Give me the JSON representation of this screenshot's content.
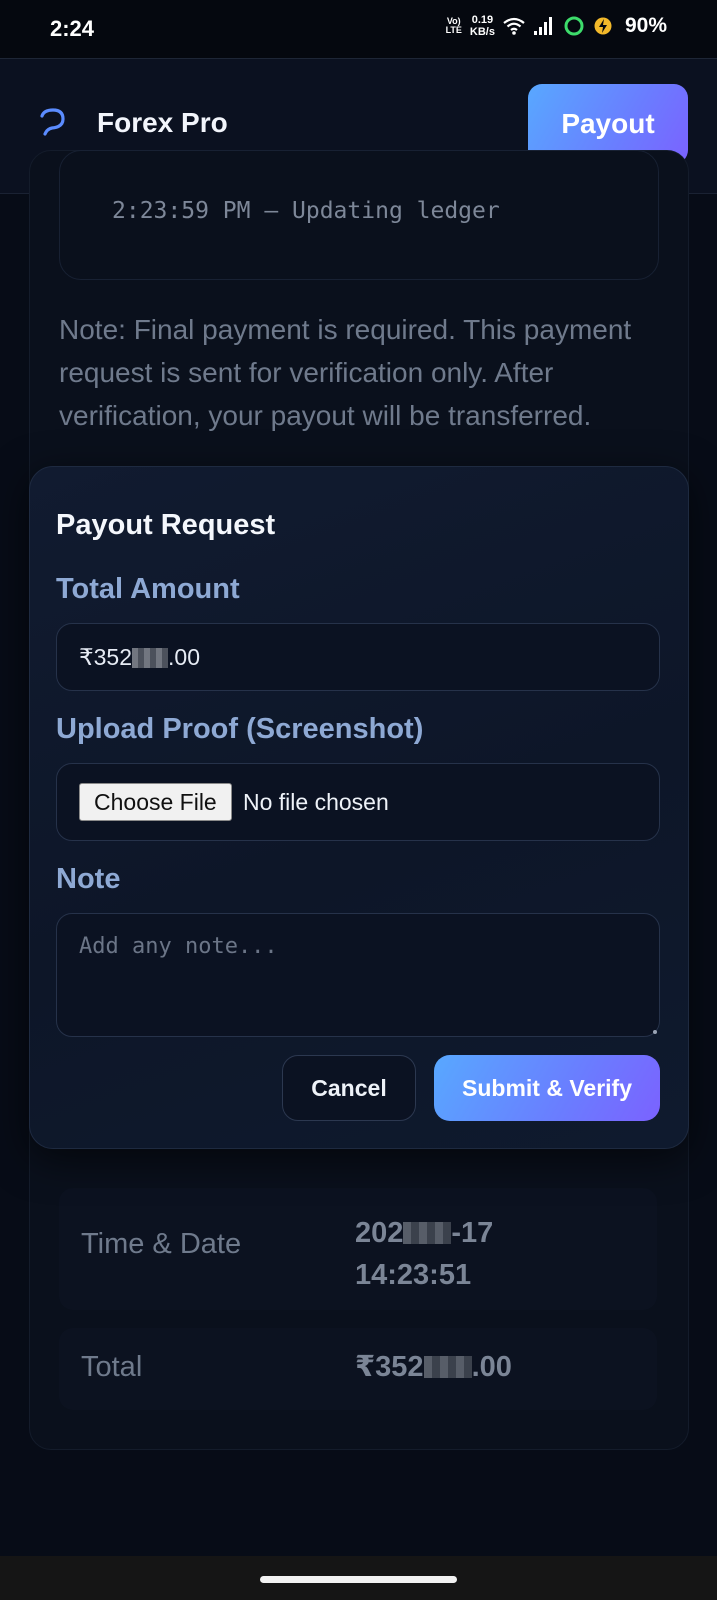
{
  "status_bar": {
    "time": "2:24",
    "volte": "Vo) LTE",
    "net_speed_value": "0.19",
    "net_speed_unit": "KB/s",
    "battery": "90%"
  },
  "header": {
    "brand": "Forex Pro",
    "payout_button": "Payout",
    "accent_gradient": [
      "#58a8ff",
      "#7b62ff"
    ]
  },
  "background": {
    "log_line": "2:23:59 PM — Updating ledger",
    "note": "Note: Final payment is required. This payment request is sent for verification only. After verification, your payout will be transferred.",
    "summary": {
      "time_label": "Time & Date",
      "time_value_date_prefix": "202",
      "time_value_date_suffix": "-17",
      "time_value_time": "14:23:51",
      "total_label": "Total",
      "total_prefix": "₹352",
      "total_suffix": ".00"
    }
  },
  "modal": {
    "title": "Payout Request",
    "amount_label": "Total Amount",
    "amount_prefix": "₹352",
    "amount_suffix": ".00",
    "upload_label": "Upload Proof (Screenshot)",
    "choose_file": "Choose File",
    "file_status": "No file chosen",
    "note_label": "Note",
    "note_placeholder": "Add any note...",
    "cancel": "Cancel",
    "submit": "Submit & Verify"
  },
  "icons": {
    "logo": "logo-icon",
    "wifi": "wifi-icon",
    "signal": "signal-icon",
    "circle": "status-circle-icon",
    "charging": "charging-icon"
  }
}
